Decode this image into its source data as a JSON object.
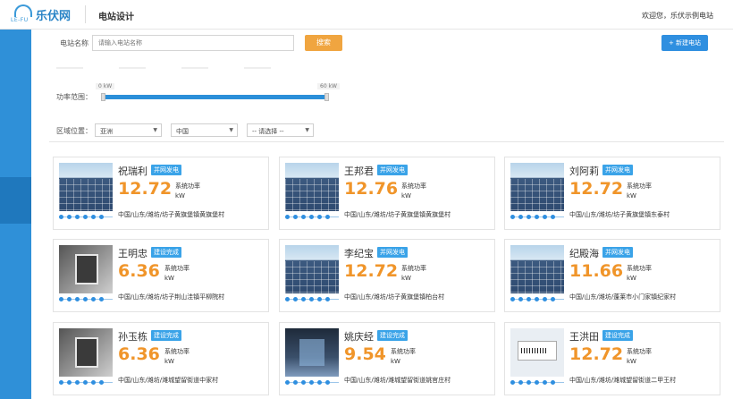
{
  "header": {
    "logo_text": "LE-FU",
    "brand": "乐伏网",
    "title": "电站设计",
    "welcome": "欢迎您，乐伏示例电站"
  },
  "filters": {
    "name_label": "电站名称",
    "name_placeholder": "请输入电站名称",
    "search_label": "搜索",
    "new_label": "+ 新建电站",
    "power_label": "功率范围：",
    "power_min": "0 kW",
    "power_max": "60 kW",
    "region_label": "区域位置：",
    "region_continent": "亚洲",
    "region_country": "中国",
    "region_province": "-- 请选择 --"
  },
  "stations": [
    {
      "name": "祝瑞利",
      "status": "并网发电",
      "power": "12.72",
      "power_label": "系统功率",
      "unit": "kW",
      "address": "中国/山东/潍坊/坊子黄旗堡镇黄旗堡村",
      "image": "solar"
    },
    {
      "name": "王邦君",
      "status": "并网发电",
      "power": "12.76",
      "power_label": "系统功率",
      "unit": "kW",
      "address": "中国/山东/潍坊/坊子黄旗堡镇黄旗堡村",
      "image": "solar"
    },
    {
      "name": "刘阿莉",
      "status": "并网发电",
      "power": "12.72",
      "power_label": "系统功率",
      "unit": "kW",
      "address": "中国/山东/潍坊/坊子黄旗堡镇东泰村",
      "image": "solar"
    },
    {
      "name": "王明忠",
      "status": "建设完成",
      "power": "6.36",
      "power_label": "系统功率",
      "unit": "kW",
      "address": "中国/山东/潍坊/坊子荆山洼镇平柳院村",
      "image": "meter"
    },
    {
      "name": "李纪宝",
      "status": "并网发电",
      "power": "12.72",
      "power_label": "系统功率",
      "unit": "kW",
      "address": "中国/山东/潍坊/坊子黄旗堡镇柏台村",
      "image": "solar"
    },
    {
      "name": "纪殿海",
      "status": "并网发电",
      "power": "11.66",
      "power_label": "系统功率",
      "unit": "kW",
      "address": "中国/山东/潍坊/蓬莱市小门家镇纪家村",
      "image": "solar"
    },
    {
      "name": "孙玉栋",
      "status": "建设完成",
      "power": "6.36",
      "power_label": "系统功率",
      "unit": "kW",
      "address": "中国/山东/潍坊/潍城望留街道中家村",
      "image": "meter"
    },
    {
      "name": "姚庆经",
      "status": "建设完成",
      "power": "9.54",
      "power_label": "系统功率",
      "unit": "kW",
      "address": "中国/山东/潍坊/潍城望留街道姚官庄村",
      "image": "dark"
    },
    {
      "name": "王洪田",
      "status": "建设完成",
      "power": "12.72",
      "power_label": "系统功率",
      "unit": "kW",
      "address": "中国/山东/潍坊/潍城望留街道二甲王村",
      "image": "label"
    }
  ]
}
